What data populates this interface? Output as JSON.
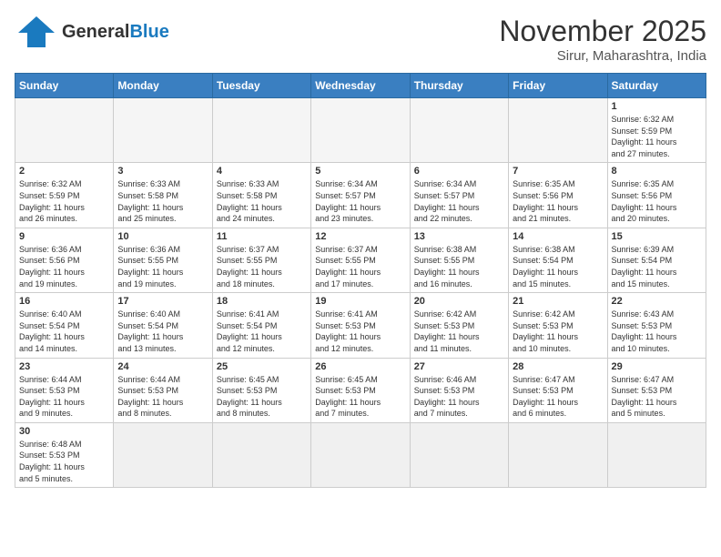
{
  "header": {
    "logo_general": "General",
    "logo_blue": "Blue",
    "month_year": "November 2025",
    "location": "Sirur, Maharashtra, India"
  },
  "weekdays": [
    "Sunday",
    "Monday",
    "Tuesday",
    "Wednesday",
    "Thursday",
    "Friday",
    "Saturday"
  ],
  "weeks": [
    [
      {
        "day": "",
        "info": ""
      },
      {
        "day": "",
        "info": ""
      },
      {
        "day": "",
        "info": ""
      },
      {
        "day": "",
        "info": ""
      },
      {
        "day": "",
        "info": ""
      },
      {
        "day": "",
        "info": ""
      },
      {
        "day": "1",
        "info": "Sunrise: 6:32 AM\nSunset: 5:59 PM\nDaylight: 11 hours\nand 27 minutes."
      }
    ],
    [
      {
        "day": "2",
        "info": "Sunrise: 6:32 AM\nSunset: 5:59 PM\nDaylight: 11 hours\nand 26 minutes."
      },
      {
        "day": "3",
        "info": "Sunrise: 6:33 AM\nSunset: 5:58 PM\nDaylight: 11 hours\nand 25 minutes."
      },
      {
        "day": "4",
        "info": "Sunrise: 6:33 AM\nSunset: 5:58 PM\nDaylight: 11 hours\nand 24 minutes."
      },
      {
        "day": "5",
        "info": "Sunrise: 6:34 AM\nSunset: 5:57 PM\nDaylight: 11 hours\nand 23 minutes."
      },
      {
        "day": "6",
        "info": "Sunrise: 6:34 AM\nSunset: 5:57 PM\nDaylight: 11 hours\nand 22 minutes."
      },
      {
        "day": "7",
        "info": "Sunrise: 6:35 AM\nSunset: 5:56 PM\nDaylight: 11 hours\nand 21 minutes."
      },
      {
        "day": "8",
        "info": "Sunrise: 6:35 AM\nSunset: 5:56 PM\nDaylight: 11 hours\nand 20 minutes."
      }
    ],
    [
      {
        "day": "9",
        "info": "Sunrise: 6:36 AM\nSunset: 5:56 PM\nDaylight: 11 hours\nand 19 minutes."
      },
      {
        "day": "10",
        "info": "Sunrise: 6:36 AM\nSunset: 5:55 PM\nDaylight: 11 hours\nand 19 minutes."
      },
      {
        "day": "11",
        "info": "Sunrise: 6:37 AM\nSunset: 5:55 PM\nDaylight: 11 hours\nand 18 minutes."
      },
      {
        "day": "12",
        "info": "Sunrise: 6:37 AM\nSunset: 5:55 PM\nDaylight: 11 hours\nand 17 minutes."
      },
      {
        "day": "13",
        "info": "Sunrise: 6:38 AM\nSunset: 5:55 PM\nDaylight: 11 hours\nand 16 minutes."
      },
      {
        "day": "14",
        "info": "Sunrise: 6:38 AM\nSunset: 5:54 PM\nDaylight: 11 hours\nand 15 minutes."
      },
      {
        "day": "15",
        "info": "Sunrise: 6:39 AM\nSunset: 5:54 PM\nDaylight: 11 hours\nand 15 minutes."
      }
    ],
    [
      {
        "day": "16",
        "info": "Sunrise: 6:40 AM\nSunset: 5:54 PM\nDaylight: 11 hours\nand 14 minutes."
      },
      {
        "day": "17",
        "info": "Sunrise: 6:40 AM\nSunset: 5:54 PM\nDaylight: 11 hours\nand 13 minutes."
      },
      {
        "day": "18",
        "info": "Sunrise: 6:41 AM\nSunset: 5:54 PM\nDaylight: 11 hours\nand 12 minutes."
      },
      {
        "day": "19",
        "info": "Sunrise: 6:41 AM\nSunset: 5:53 PM\nDaylight: 11 hours\nand 12 minutes."
      },
      {
        "day": "20",
        "info": "Sunrise: 6:42 AM\nSunset: 5:53 PM\nDaylight: 11 hours\nand 11 minutes."
      },
      {
        "day": "21",
        "info": "Sunrise: 6:42 AM\nSunset: 5:53 PM\nDaylight: 11 hours\nand 10 minutes."
      },
      {
        "day": "22",
        "info": "Sunrise: 6:43 AM\nSunset: 5:53 PM\nDaylight: 11 hours\nand 10 minutes."
      }
    ],
    [
      {
        "day": "23",
        "info": "Sunrise: 6:44 AM\nSunset: 5:53 PM\nDaylight: 11 hours\nand 9 minutes."
      },
      {
        "day": "24",
        "info": "Sunrise: 6:44 AM\nSunset: 5:53 PM\nDaylight: 11 hours\nand 8 minutes."
      },
      {
        "day": "25",
        "info": "Sunrise: 6:45 AM\nSunset: 5:53 PM\nDaylight: 11 hours\nand 8 minutes."
      },
      {
        "day": "26",
        "info": "Sunrise: 6:45 AM\nSunset: 5:53 PM\nDaylight: 11 hours\nand 7 minutes."
      },
      {
        "day": "27",
        "info": "Sunrise: 6:46 AM\nSunset: 5:53 PM\nDaylight: 11 hours\nand 7 minutes."
      },
      {
        "day": "28",
        "info": "Sunrise: 6:47 AM\nSunset: 5:53 PM\nDaylight: 11 hours\nand 6 minutes."
      },
      {
        "day": "29",
        "info": "Sunrise: 6:47 AM\nSunset: 5:53 PM\nDaylight: 11 hours\nand 5 minutes."
      }
    ],
    [
      {
        "day": "30",
        "info": "Sunrise: 6:48 AM\nSunset: 5:53 PM\nDaylight: 11 hours\nand 5 minutes."
      },
      {
        "day": "",
        "info": ""
      },
      {
        "day": "",
        "info": ""
      },
      {
        "day": "",
        "info": ""
      },
      {
        "day": "",
        "info": ""
      },
      {
        "day": "",
        "info": ""
      },
      {
        "day": "",
        "info": ""
      }
    ]
  ]
}
